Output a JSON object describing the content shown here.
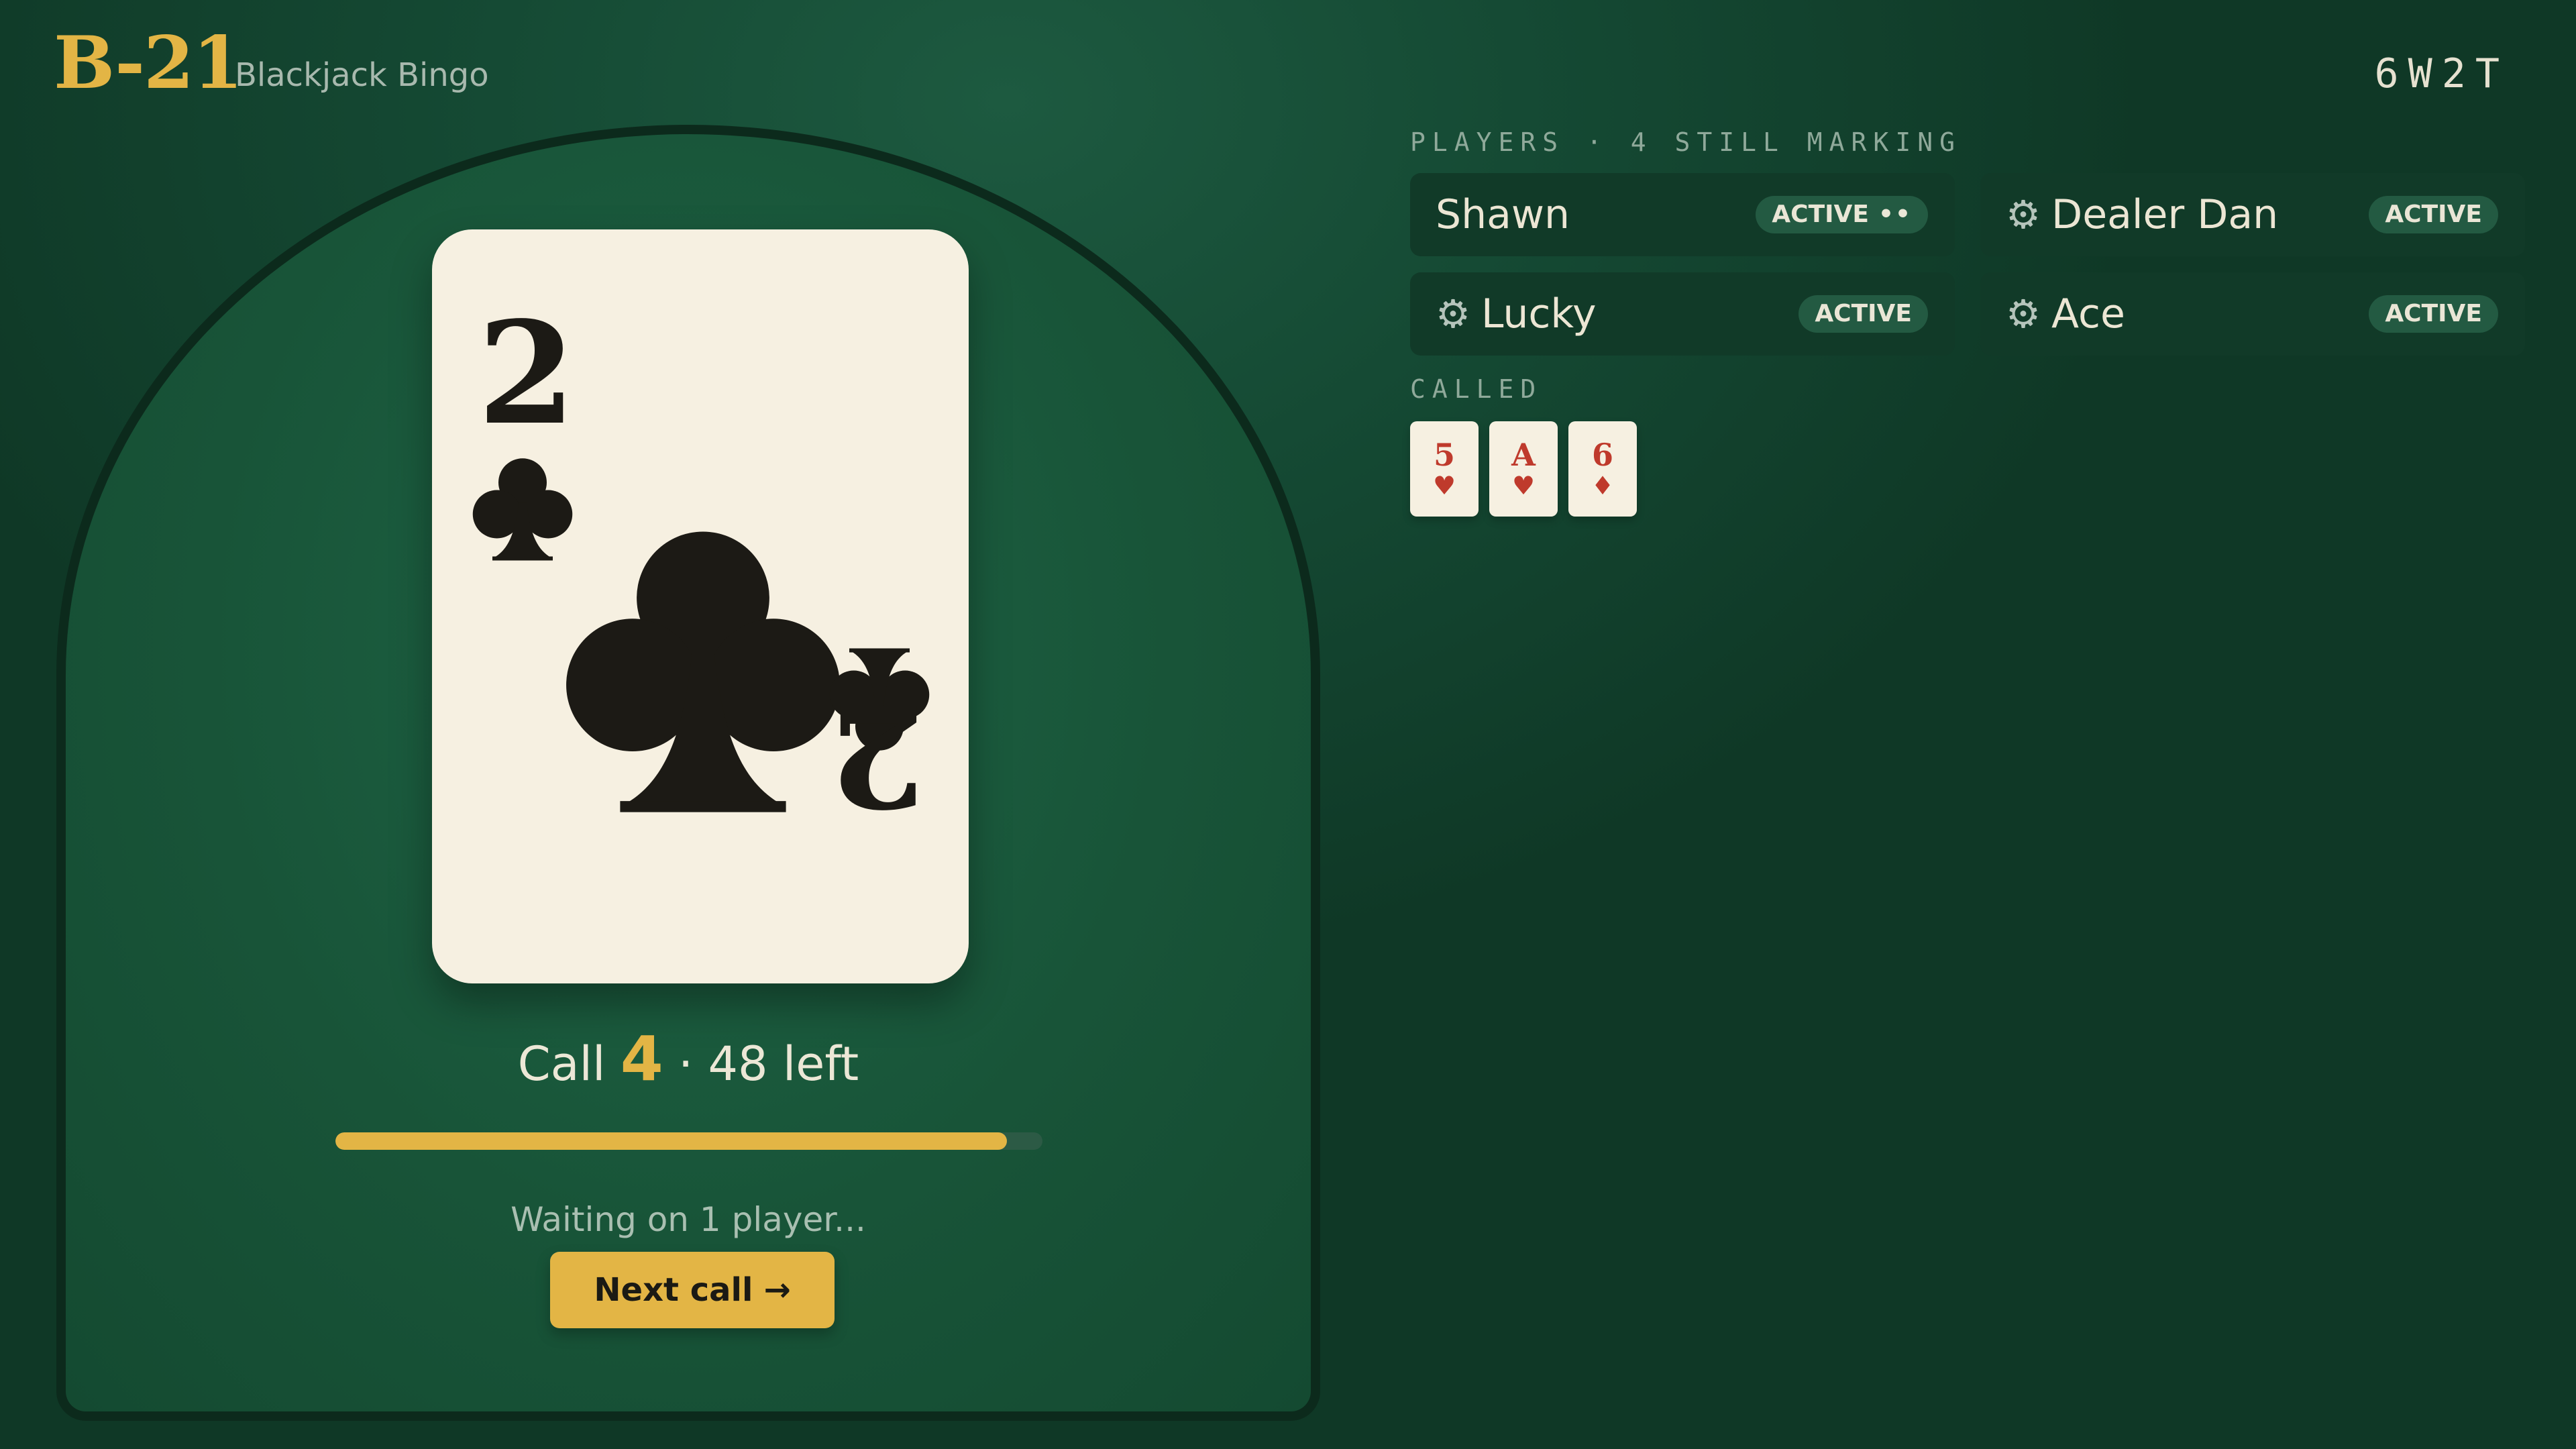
{
  "header": {
    "logo": "B-21",
    "subtitle": "Blackjack Bingo",
    "room_code": "6W2T"
  },
  "current_card": {
    "rank": "2",
    "suit": "clubs",
    "suit_symbol": "♣",
    "ink_color": "#1c1a15",
    "face_color": "#f6f0e1"
  },
  "status": {
    "call_prefix": "Call",
    "call_number": "4",
    "remaining": "· 48 left",
    "progress": 0.95,
    "waiting_text": "Waiting on 1 player...",
    "next_label": "Next call",
    "next_arrow": "→"
  },
  "players_section": {
    "label": "PLAYERS · 4 STILL MARKING",
    "players": [
      {
        "name": "Shawn",
        "badge": "ACTIVE",
        "typing_dots": "••",
        "bot": false,
        "icon": ""
      },
      {
        "name": "Dealer Dan",
        "badge": "ACTIVE",
        "bot": true,
        "icon": "gear-icon"
      },
      {
        "name": "Lucky",
        "badge": "ACTIVE",
        "bot": true,
        "icon": "gear-icon"
      },
      {
        "name": "Ace",
        "badge": "ACTIVE",
        "bot": true,
        "icon": "gear-icon"
      }
    ]
  },
  "called_section": {
    "label": "CALLED",
    "cards": [
      {
        "rank": "5",
        "suit": "♥"
      },
      {
        "rank": "A",
        "suit": "♥"
      },
      {
        "rank": "6",
        "suit": "♦"
      }
    ]
  },
  "colors": {
    "accent": "#e3b545",
    "felt": "#185438",
    "card_red": "#bf3a2c"
  }
}
